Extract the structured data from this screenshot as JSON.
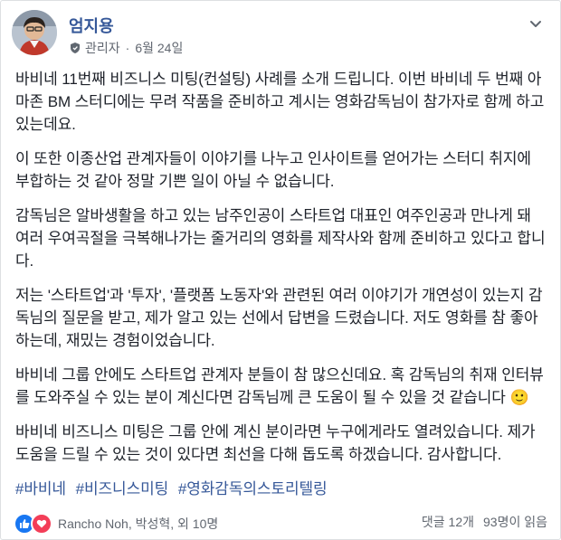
{
  "post": {
    "author": "엄지용",
    "role": "관리자",
    "date": "6월 24일",
    "paragraphs": [
      "바비네 11번째 비즈니스 미팅(컨설팅) 사례를 소개 드립니다. 이번 바비네 두 번째 아마존 BM 스터디에는 무려 작품을 준비하고 계시는 영화감독님이 참가자로 함께 하고 있는데요.",
      "이 또한 이종산업 관계자들이 이야기를 나누고 인사이트를 얻어가는 스터디 취지에 부합하는 것 같아 정말 기쁜 일이 아닐 수 없습니다.",
      "감독님은 알바생활을 하고 있는 남주인공이 스타트업 대표인 여주인공과 만나게 돼 여러 우여곡절을 극복해나가는 줄거리의 영화를 제작사와 함께 준비하고 있다고 합니다.",
      "저는 '스타트업'과 '투자', '플랫폼 노동자'와 관련된 여러 이야기가 개연성이 있는지 감독님의 질문을 받고, 제가 알고 있는 선에서 답변을 드렸습니다. 저도 영화를 참 좋아하는데, 재밌는 경험이었습니다.",
      "바비네 그룹 안에도 스타트업 관계자 분들이 참 많으신데요. 혹 감독님의 취재 인터뷰를 도와주실 수 있는 분이 계신다면 감독님께 큰 도움이 될 수 있을 것 같습니다 🙂",
      "바비네 비즈니스 미팅은 그룹 안에 계신 분이라면 누구에게라도 열려있습니다. 제가 도움을 드릴 수 있는 것이 있다면 최선을 다해 돕도록 하겠습니다. 감사합니다."
    ],
    "hashtags": [
      "#바비네",
      "#비즈니스미팅",
      "#영화감독의스토리텔링"
    ]
  },
  "footer": {
    "reaction_names": "Rancho Noh, 박성혁, 외 10명",
    "comments": "댓글 12개",
    "seen": "93명이 읽음"
  },
  "icons": {
    "role": "admin-shield-icon",
    "menu": "chevron-down-icon",
    "like": "like-icon",
    "love": "love-icon"
  },
  "colors": {
    "link": "#365899",
    "like": "#1877f2",
    "love": "#f33e58",
    "meta": "#616770"
  }
}
